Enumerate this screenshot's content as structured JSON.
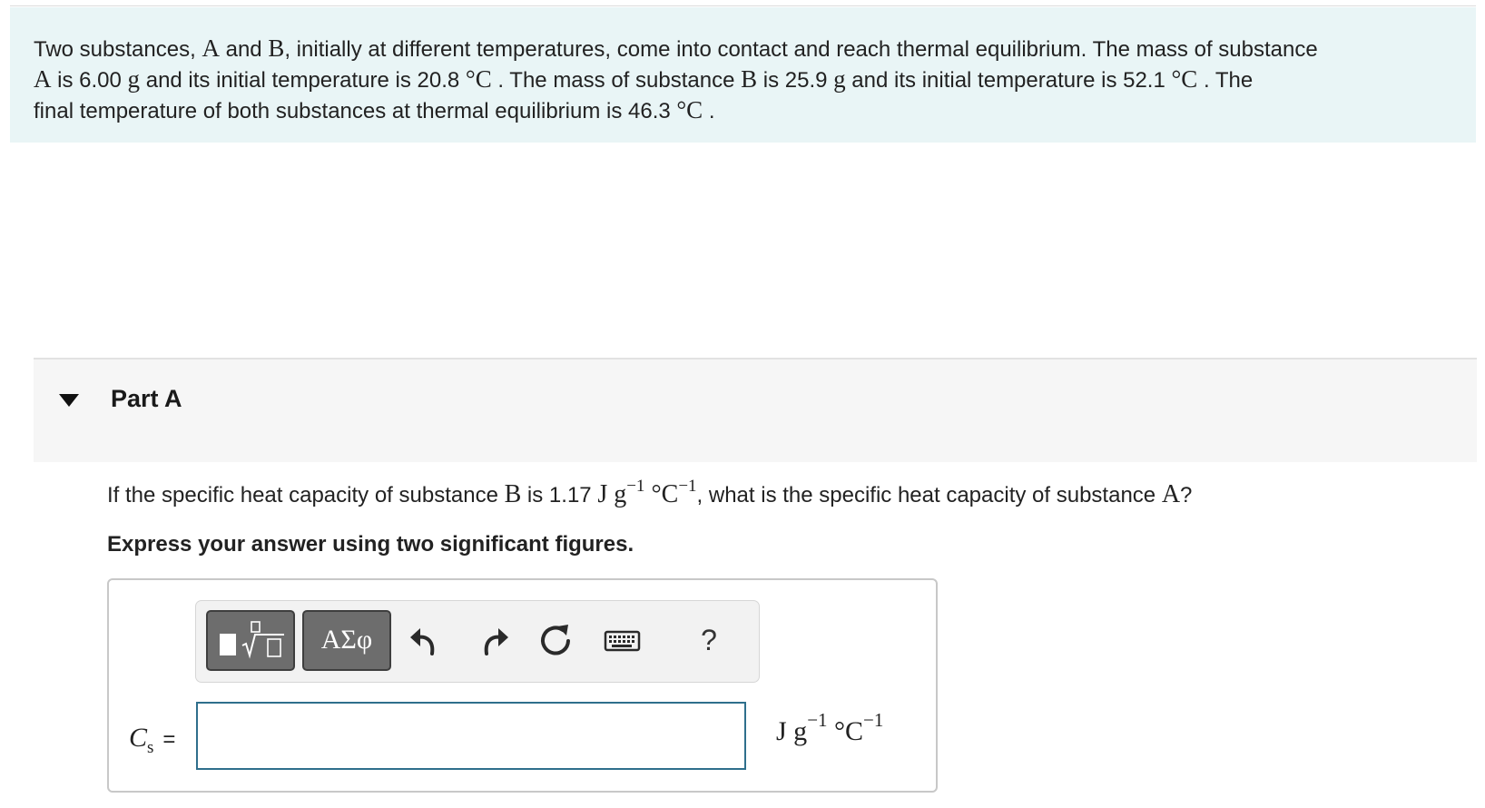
{
  "intro": {
    "s1": "Two substances, ",
    "m1": "A",
    "s2": " and ",
    "m2": "B",
    "s3": ", initially at different temperatures, come into contact and reach thermal equilibrium. The mass of substance",
    "m3": "A",
    "s4": " is 6.00  ",
    "m4": "g",
    "s5": " and its initial temperature is 20.8  ",
    "m5": "°C",
    "s6": " . The mass of substance ",
    "m6": "B",
    "s7": " is 25.9  ",
    "m7": "g",
    "s8": " and its initial temperature is 52.1  ",
    "m8": "°C",
    "s9": " . The",
    "s10": "final temperature of both substances at thermal equilibrium is 46.3  ",
    "m9": "°C",
    "s11": " ."
  },
  "part": {
    "title": "Part A"
  },
  "question": {
    "q1": "If the specific heat capacity of substance ",
    "qB": "B",
    "q2": " is 1.17 ",
    "qJg": "J g",
    "qexp1": "−1",
    "qdegC": " °C",
    "qexp2": "−1",
    "q3": ", what is the specific heat capacity of substance ",
    "qA": "A",
    "q4": "?",
    "instruction": "Express your answer using two significant figures."
  },
  "toolbar": {
    "symbols_label": "ΑΣφ",
    "help_label": "?"
  },
  "answer": {
    "var_main": "C",
    "var_sub": "s",
    "equals": "=",
    "value": "",
    "unit_jg": "J g",
    "unit_exp1": "−1",
    "unit_degc": " °C",
    "unit_exp2": "−1"
  }
}
